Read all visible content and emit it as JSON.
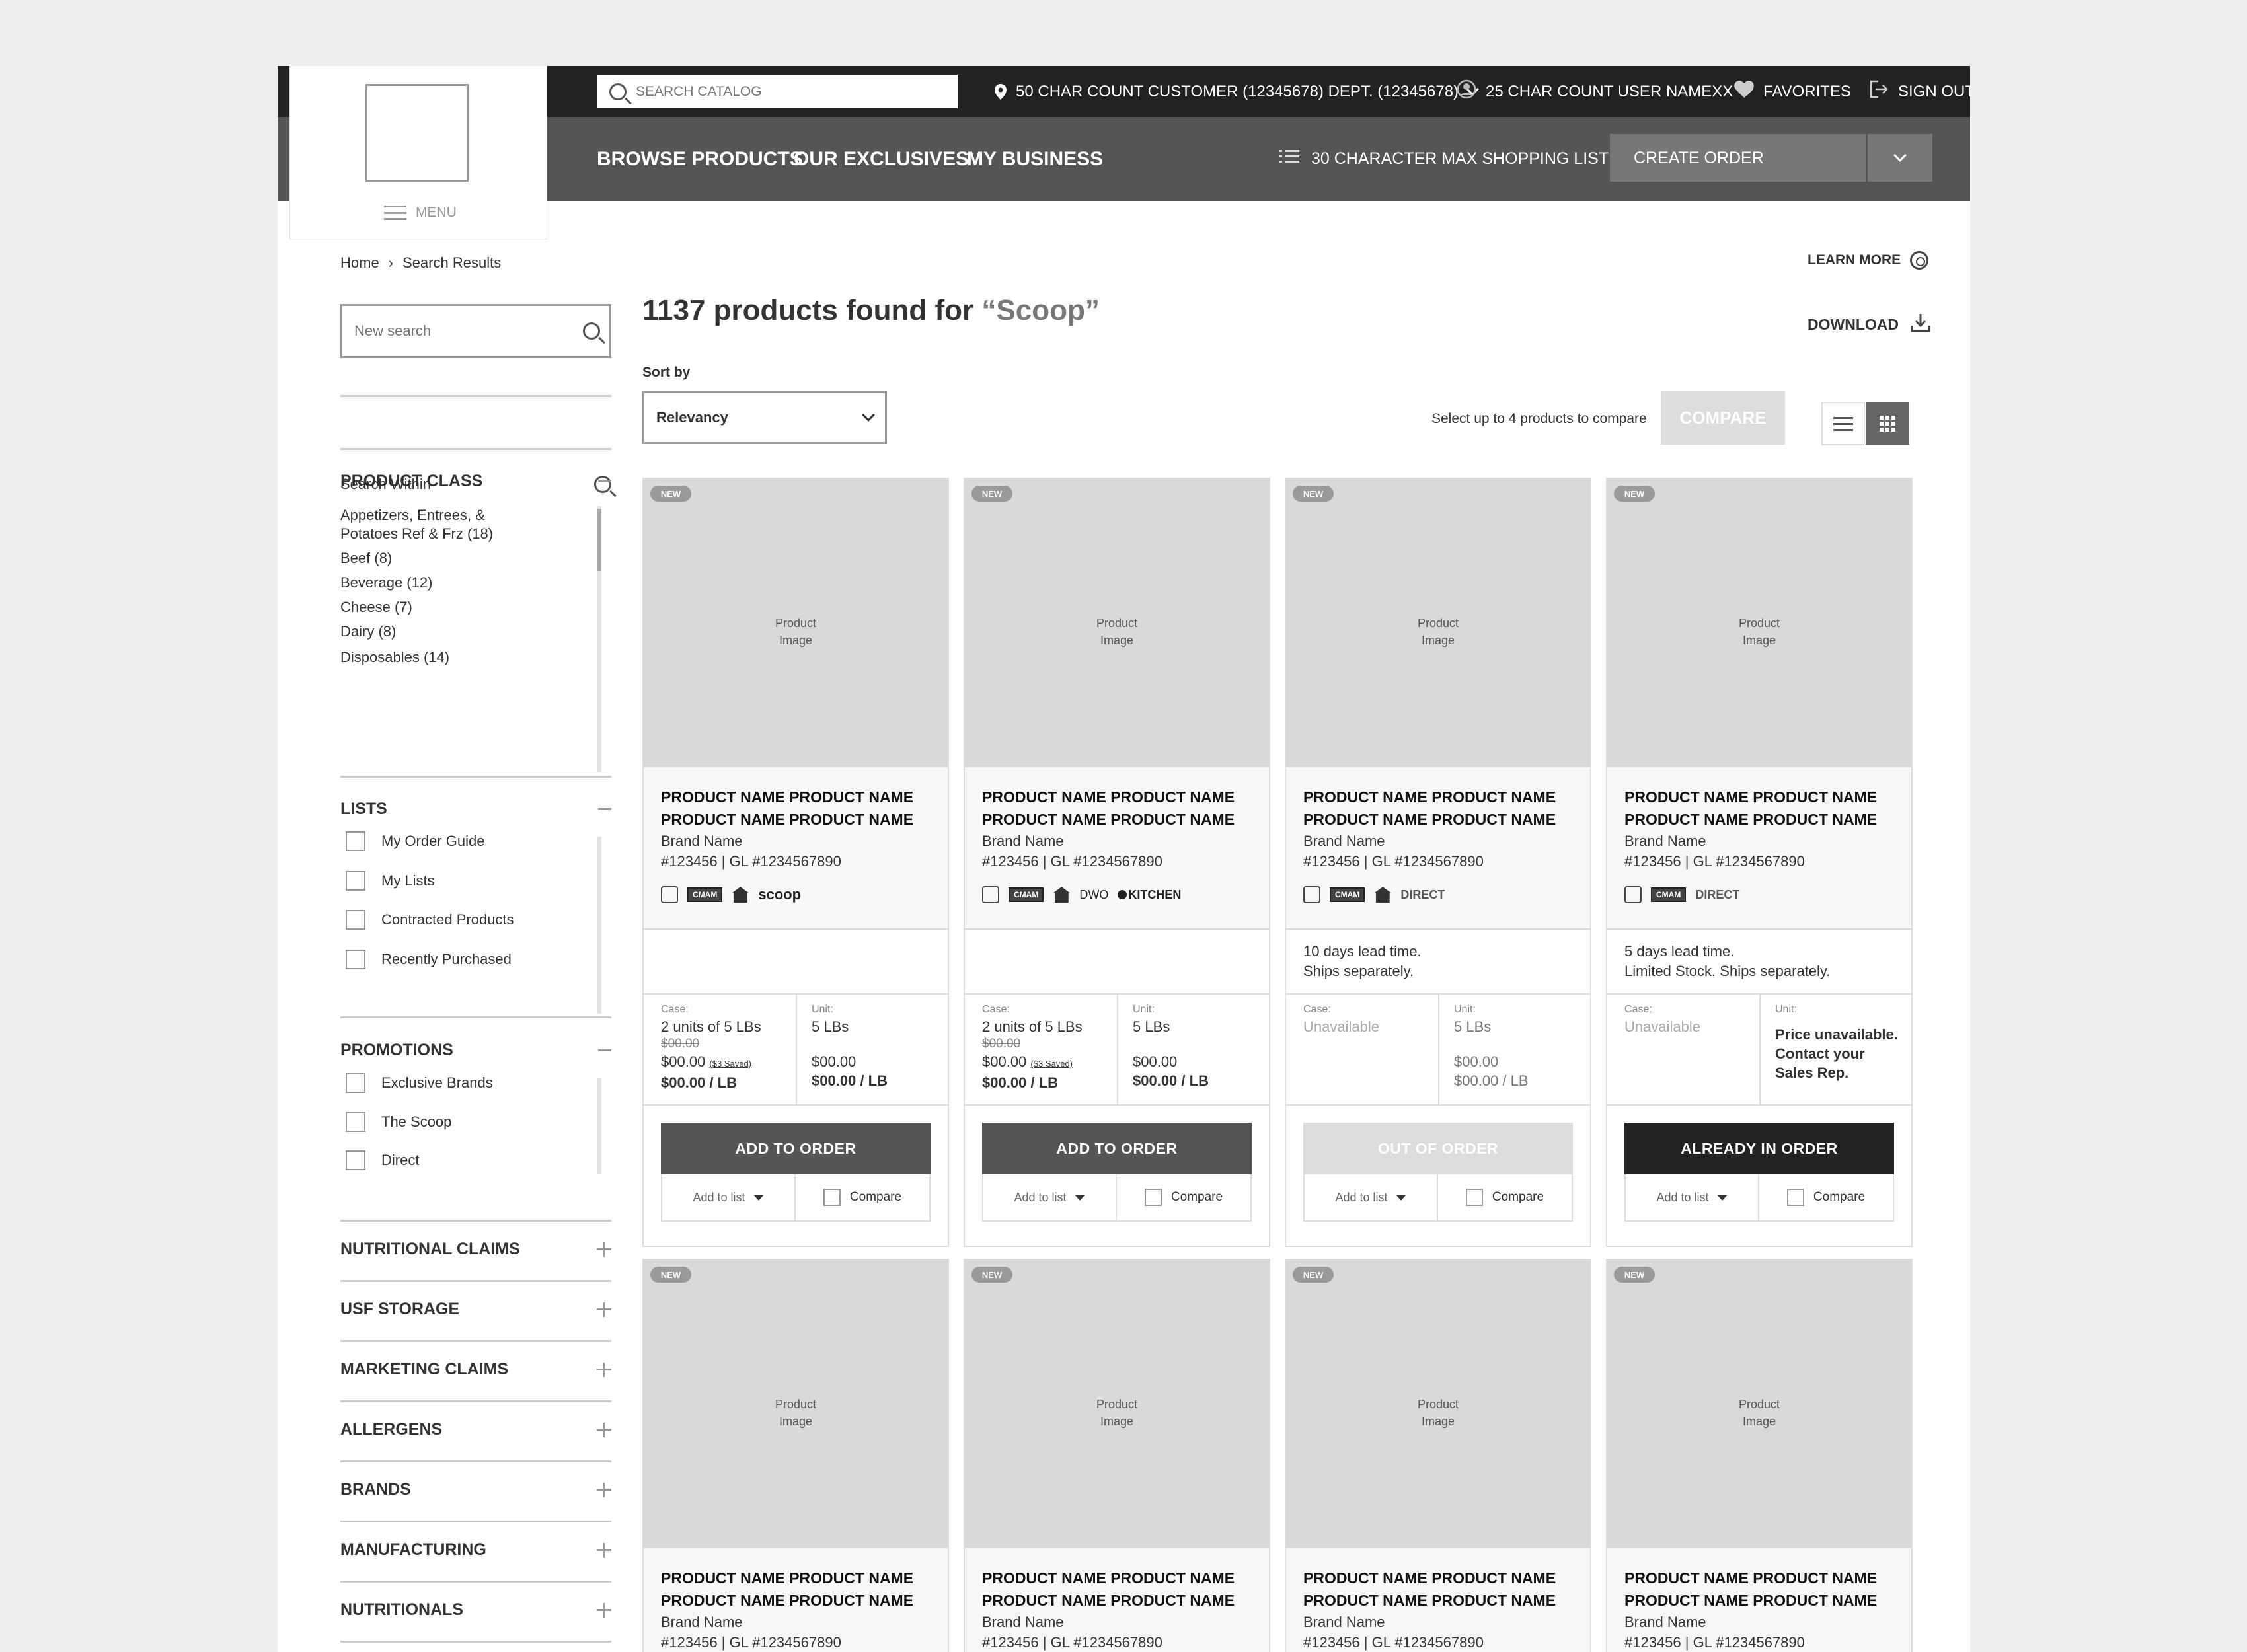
{
  "header": {
    "search_placeholder": "SEARCH CATALOG",
    "customer": "50 CHAR COUNT CUSTOMER (12345678) DEPT. (12345678)",
    "user": "25 CHAR COUNT USER NAMEXX",
    "favorites": "FAVORITES",
    "sign_out": "SIGN OUT",
    "menu": "MENU"
  },
  "nav": {
    "browse": "BROWSE PRODUCTS",
    "exclusives": "OUR EXCLUSIVES",
    "business": "MY BUSINESS",
    "shopping_list": "30 CHARACTER MAX SHOPPING LIST",
    "create_order": "CREATE ORDER"
  },
  "breadcrumb": {
    "home": "Home",
    "sep": "›",
    "current": "Search Results"
  },
  "learn_more": "LEARN MORE",
  "download": "DOWNLOAD",
  "sidebar": {
    "new_search_placeholder": "New search",
    "search_within": "Search Within",
    "product_class": {
      "title": "PRODUCT CLASS",
      "items": [
        "Appetizers, Entrees, &",
        "Potatoes Ref & Frz (18)",
        "Beef (8)",
        "Beverage (12)",
        "Cheese (7)",
        "Dairy (8)",
        "Disposables (14)"
      ]
    },
    "lists": {
      "title": "LISTS",
      "items": [
        "My Order Guide",
        "My Lists",
        "Contracted Products",
        "Recently Purchased"
      ]
    },
    "promotions": {
      "title": "PROMOTIONS",
      "items": [
        "Exclusive Brands",
        "The Scoop",
        "Direct"
      ]
    },
    "collapsed": [
      "NUTRITIONAL CLAIMS",
      "USF STORAGE",
      "MARKETING CLAIMS",
      "ALLERGENS",
      "BRANDS",
      "MANUFACTURING",
      "NUTRITIONALS"
    ]
  },
  "results": {
    "count_text": "1137 products found for",
    "query": "“Scoop”",
    "sort_label": "Sort by",
    "sort_value": "Relevancy",
    "compare_hint": "Select up to 4 products to compare",
    "compare_button": "COMPARE"
  },
  "cards": [
    {
      "badge": "NEW",
      "image": [
        "Product",
        "Image"
      ],
      "name1": "PRODUCT NAME PRODUCT NAME",
      "name2": "PRODUCT NAME PRODUCT NAME",
      "brand": "Brand Name",
      "sku": "#123456  |  GL #1234567890",
      "tags": [
        "scoop"
      ],
      "lead": [
        "",
        ""
      ],
      "case_label": "Case:",
      "case_value": "2 units of 5 LBs",
      "case_old": "$00.00",
      "case_price": "$00.00",
      "case_saved": "($3 Saved)",
      "case_per": "$00.00 / LB",
      "unit_label": "Unit:",
      "unit_value": "5 LBs",
      "unit_price": "$00.00",
      "unit_per": "$00.00 / LB",
      "action": "ADD TO ORDER",
      "add_to_list": "Add to list",
      "compare": "Compare"
    },
    {
      "badge": "NEW",
      "image": [
        "Product",
        "Image"
      ],
      "name1": "PRODUCT NAME PRODUCT NAME",
      "name2": "PRODUCT NAME PRODUCT NAME",
      "brand": "Brand Name",
      "sku": "#123456  |  GL #1234567890",
      "tags": [
        "DWO",
        "KITCHEN"
      ],
      "lead": [
        "",
        ""
      ],
      "case_label": "Case:",
      "case_value": "2 units of 5 LBs",
      "case_old": "$00.00",
      "case_price": "$00.00",
      "case_saved": "($3 Saved)",
      "case_per": "$00.00 / LB",
      "unit_label": "Unit:",
      "unit_value": "5 LBs",
      "unit_price": "$00.00",
      "unit_per": "$00.00 / LB",
      "action": "ADD TO ORDER",
      "add_to_list": "Add to list",
      "compare": "Compare"
    },
    {
      "badge": "NEW",
      "image": [
        "Product",
        "Image"
      ],
      "name1": "PRODUCT NAME PRODUCT NAME",
      "name2": "PRODUCT NAME PRODUCT NAME",
      "brand": "Brand Name",
      "sku": "#123456  |  GL #1234567890",
      "tags": [
        "DIRECT"
      ],
      "lead": [
        "10 days lead time.",
        "Ships separately."
      ],
      "case_label": "Case:",
      "case_value": "Unavailable",
      "unit_label": "Unit:",
      "unit_value": "5 LBs",
      "unit_price": "$00.00",
      "unit_per": "$00.00 / LB",
      "action": "OUT OF ORDER",
      "add_to_list": "Add to list",
      "compare": "Compare"
    },
    {
      "badge": "NEW",
      "image": [
        "Product",
        "Image"
      ],
      "name1": "PRODUCT NAME PRODUCT NAME",
      "name2": "PRODUCT NAME PRODUCT NAME",
      "brand": "Brand Name",
      "sku": "#123456  |  GL #1234567890",
      "tags": [
        "DIRECT"
      ],
      "lead": [
        "5 days lead time.",
        "Limited Stock. Ships separately."
      ],
      "case_label": "Case:",
      "case_value": "Unavailable",
      "unit_label": "Unit:",
      "unit_msg": [
        "Price unavailable.",
        "Contact your",
        "Sales Rep."
      ],
      "action": "ALREADY IN ORDER",
      "add_to_list": "Add to list",
      "compare": "Compare"
    }
  ],
  "cards_row2": [
    {
      "badge": "NEW",
      "image": [
        "Product",
        "Image"
      ],
      "name1": "PRODUCT NAME PRODUCT NAME",
      "name2": "PRODUCT NAME PRODUCT NAME",
      "brand": "Brand Name",
      "sku": "#123456  |  GL #1234567890"
    },
    {
      "badge": "NEW",
      "image": [
        "Product",
        "Image"
      ],
      "name1": "PRODUCT NAME PRODUCT NAME",
      "name2": "PRODUCT NAME PRODUCT NAME",
      "brand": "Brand Name",
      "sku": "#123456  |  GL #1234567890"
    },
    {
      "badge": "NEW",
      "image": [
        "Product",
        "Image"
      ],
      "name1": "PRODUCT NAME PRODUCT NAME",
      "name2": "PRODUCT NAME PRODUCT NAME",
      "brand": "Brand Name",
      "sku": "#123456  |  GL #1234567890"
    },
    {
      "badge": "NEW",
      "image": [
        "Product",
        "Image"
      ],
      "name1": "PRODUCT NAME PRODUCT NAME",
      "name2": "PRODUCT NAME PRODUCT NAME",
      "brand": "Brand Name",
      "sku": "#123456  |  GL #1234567890"
    }
  ],
  "colors": {
    "topbar": "#222222",
    "navbar": "#555555",
    "button_add": "#555555",
    "button_already": "#222222",
    "button_disabled": "#dddddd"
  }
}
